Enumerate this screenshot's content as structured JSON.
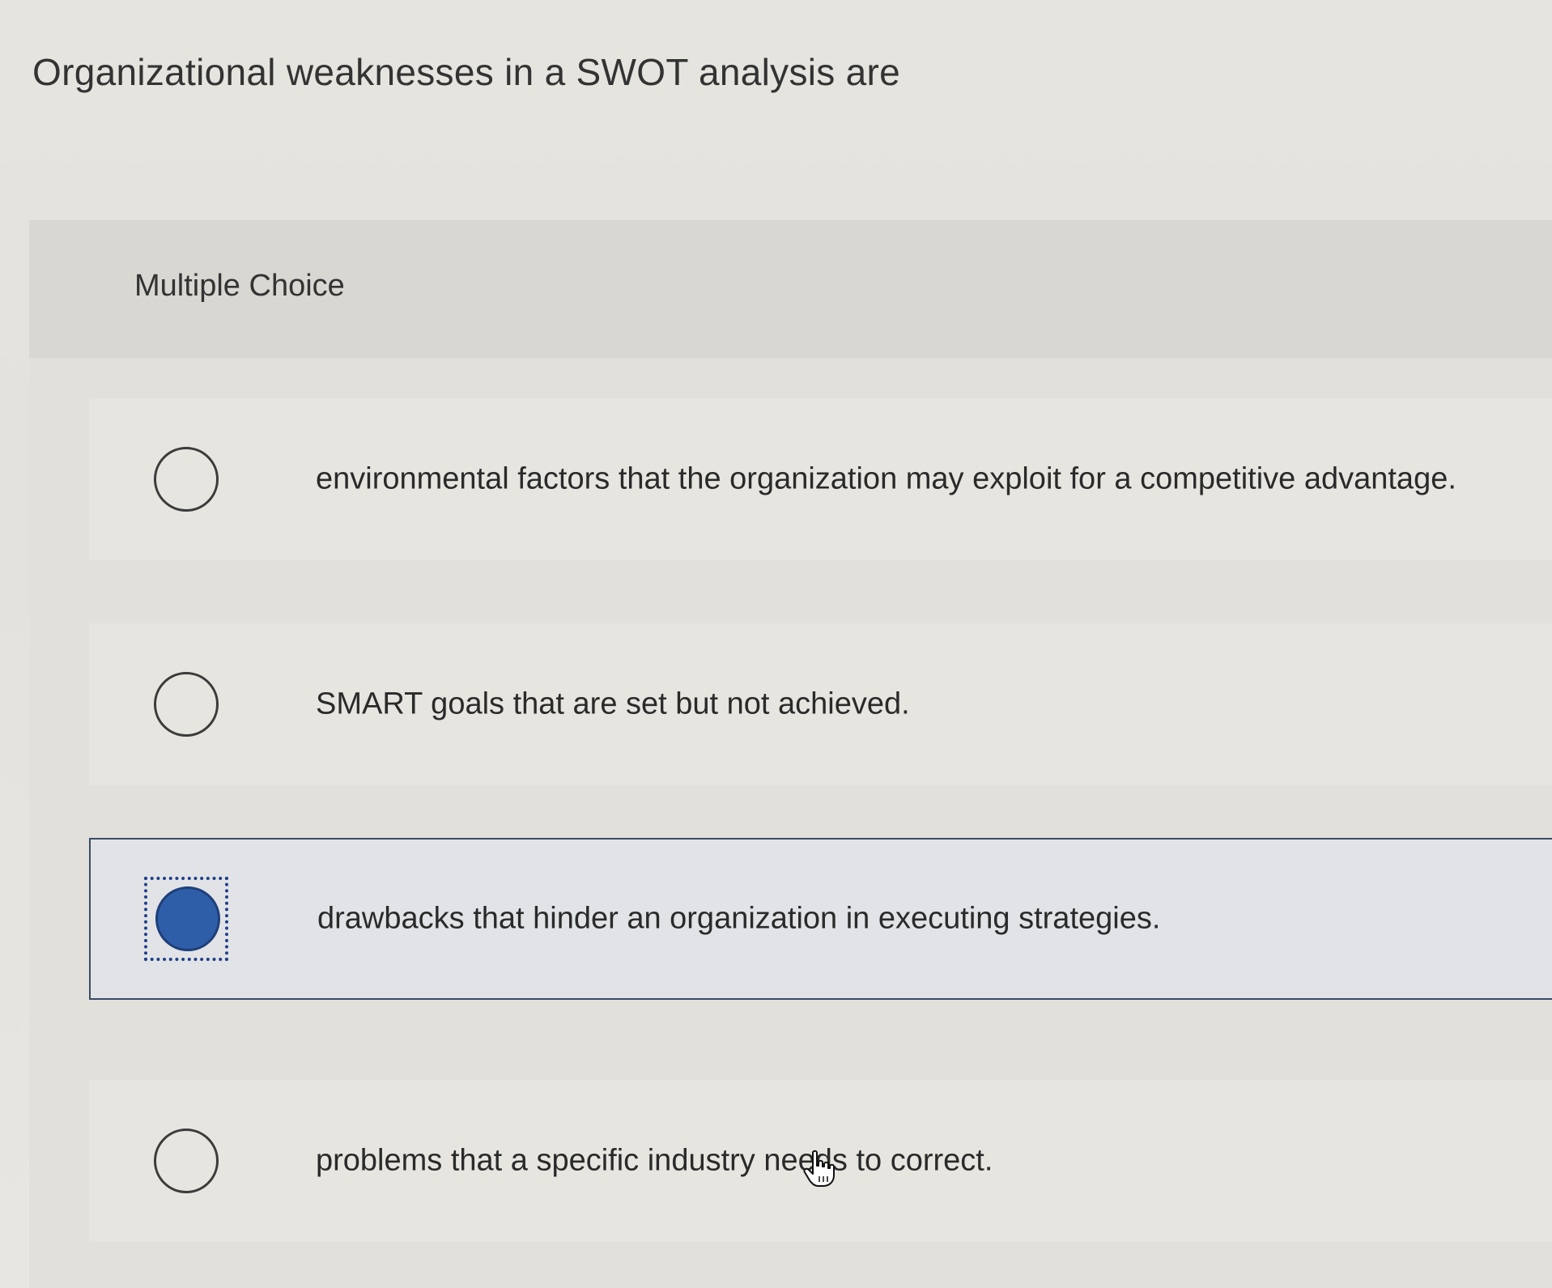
{
  "question": {
    "text": "Organizational weaknesses in a SWOT analysis are"
  },
  "panel": {
    "label": "Multiple Choice"
  },
  "options": [
    {
      "text": "environmental factors that the organization may exploit for a competitive advantage.",
      "selected": false
    },
    {
      "text": "SMART goals that are set but not achieved.",
      "selected": false
    },
    {
      "text": "drawbacks that hinder an organization in executing strategies.",
      "selected": true
    },
    {
      "text": "problems that a specific industry needs to correct.",
      "selected": false
    }
  ],
  "colors": {
    "selected_radio": "#2f5ea8",
    "focus_outline": "#1f3f8a",
    "selected_border": "#3a4a66"
  },
  "icons": {
    "cursor": "hand-pointer-icon"
  }
}
